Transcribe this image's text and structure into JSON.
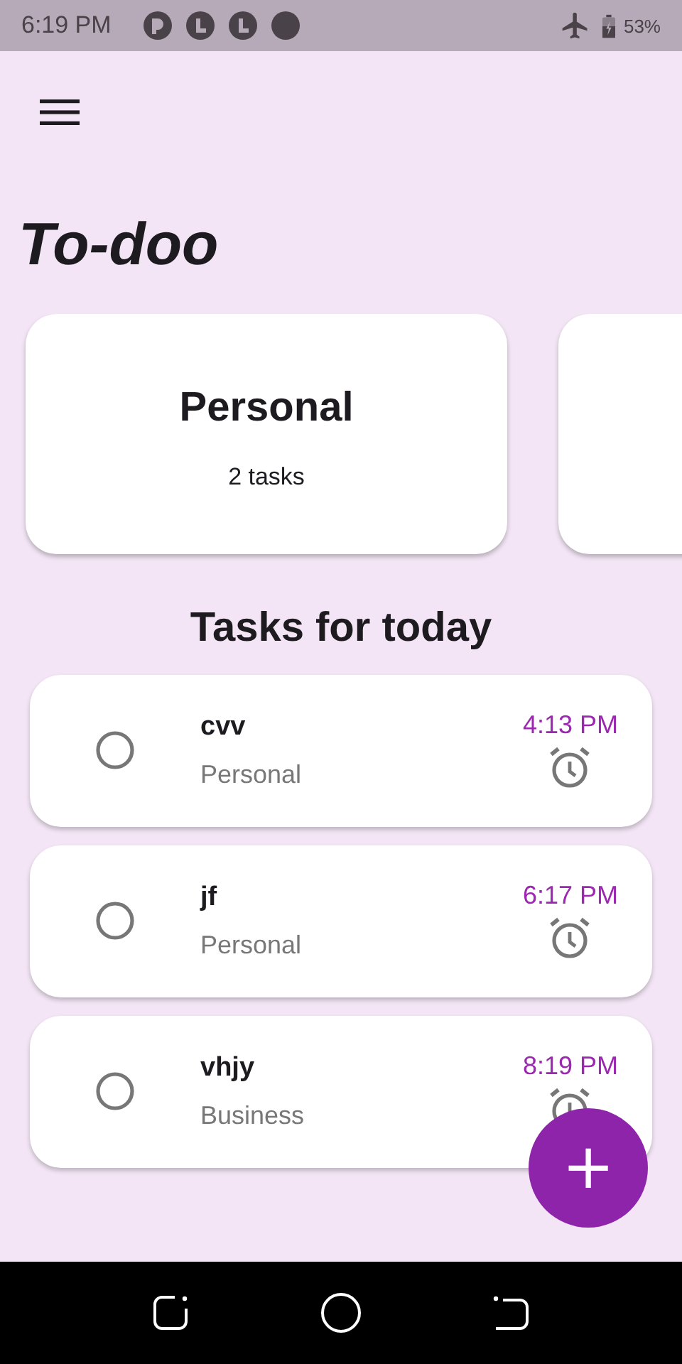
{
  "status_bar": {
    "time": "6:19 PM",
    "battery": "53%"
  },
  "app": {
    "title": "To-doo"
  },
  "categories": [
    {
      "kind": "full",
      "name": "Personal",
      "count": "2 tasks"
    },
    {
      "kind": "partial"
    }
  ],
  "section_title": "Tasks for today",
  "tasks": [
    {
      "title": "cvv",
      "category": "Personal",
      "time": "4:13 PM",
      "checked": false
    },
    {
      "title": "jf",
      "category": "Personal",
      "time": "6:17 PM",
      "checked": false
    },
    {
      "title": "vhjy",
      "category": "Business",
      "time": "8:19 PM",
      "checked": false
    }
  ],
  "fab": {
    "label": "+"
  }
}
